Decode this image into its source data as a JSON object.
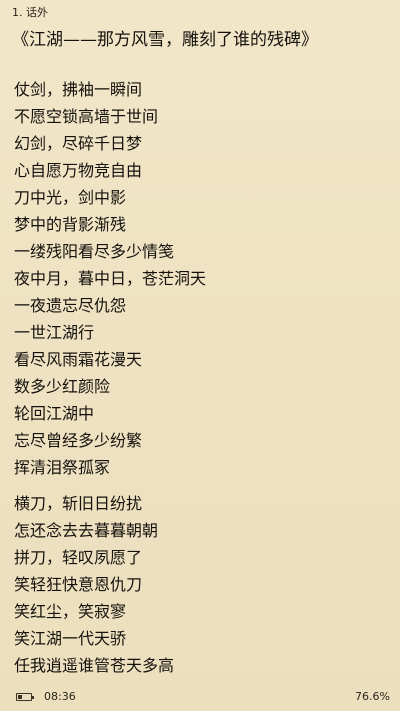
{
  "header": {
    "chapter": "1. 话外"
  },
  "content": {
    "title": "《江湖——那方风雪，雕刻了谁的残碑》",
    "stanzas": [
      [
        "仗剑，拂袖一瞬间",
        "不愿空锁高墙于世间",
        "幻剑，尽碎千日梦",
        "心自愿万物竞自由",
        "刀中光，剑中影",
        "梦中的背影渐残",
        "一缕残阳看尽多少情笺",
        "夜中月，暮中日，苍茫洞天",
        "一夜遗忘尽仇怨",
        "一世江湖行",
        "看尽风雨霜花漫天",
        "数多少红颜险",
        "轮回江湖中",
        "忘尽曾经多少纷繁",
        "挥清泪祭孤冢"
      ],
      [
        "横刀，斩旧日纷扰",
        "怎还念去去暮暮朝朝",
        "拼刀，轻叹夙愿了",
        "笑轻狂快意恩仇刀",
        "笑红尘，笑寂寥",
        "笑江湖一代天骄",
        "任我逍遥谁管苍天多高"
      ]
    ]
  },
  "status": {
    "time": "08:36",
    "progress": "76.6%",
    "battery_level": 0.35
  },
  "icons": {
    "battery": "battery-icon"
  }
}
